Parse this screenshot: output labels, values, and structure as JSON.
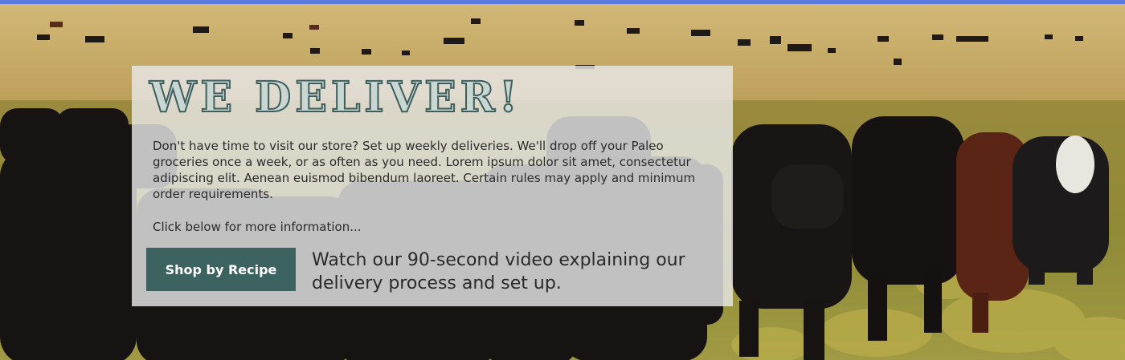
{
  "colors": {
    "top_bar": "#5b7be0",
    "headline_fill": "#c9d6d2",
    "headline_outline": "#3d5e5c",
    "button": "#3d6361",
    "panel": "#e8e8e8"
  },
  "hero": {
    "image": "pasture-with-cattle",
    "headline": "WE DELIVER!",
    "body": "Don't have time to visit our store? Set up weekly deliveries. We'll drop off your Paleo groceries once a week, or as often as you need. Lorem ipsum dolor sit amet, consectetur adipiscing elit. Aenean euismod bibendum laoreet. Certain rules may apply and minimum order requirements.",
    "more_info": "Click below for more information...",
    "button_label": "Shop by Recipe",
    "video_text": "Watch our 90-second video explaining our delivery process and set up."
  }
}
